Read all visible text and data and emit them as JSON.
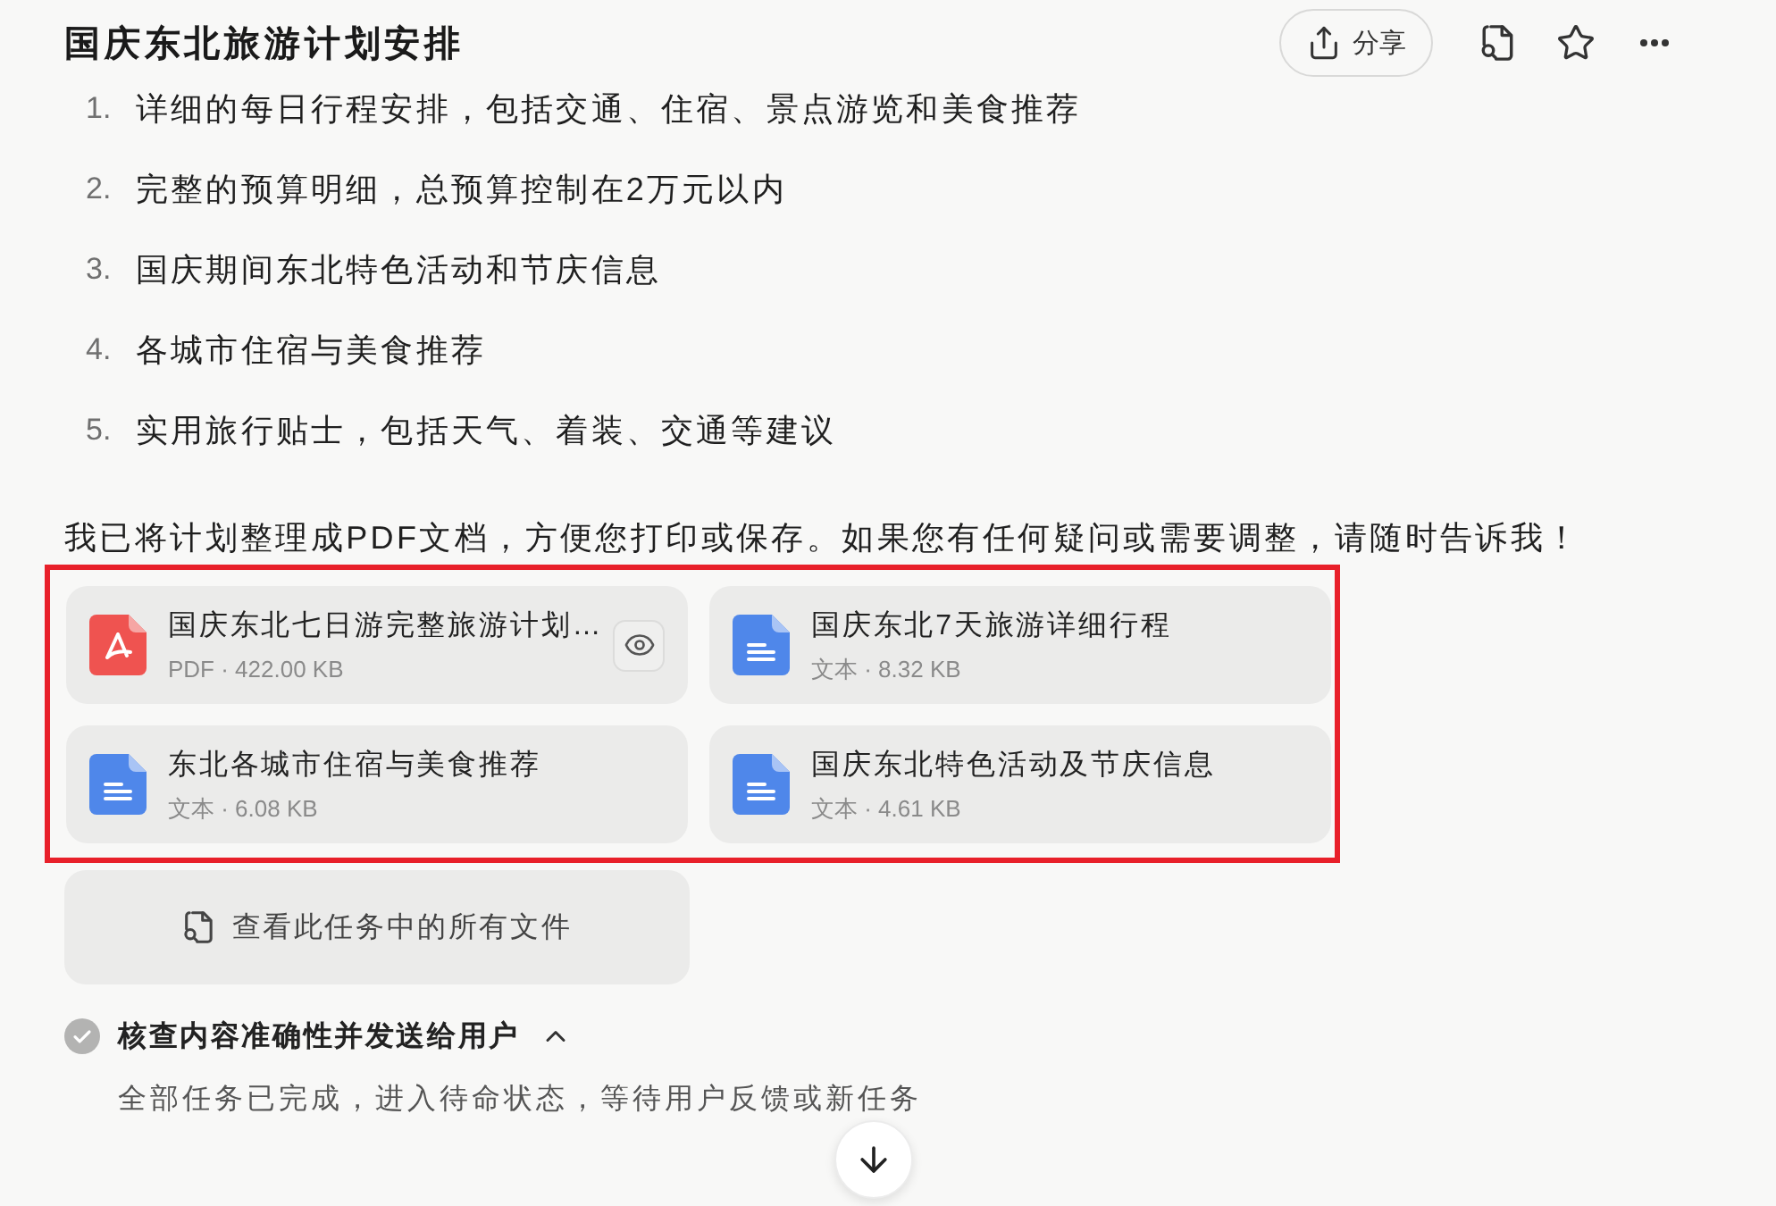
{
  "header": {
    "title": "国庆东北旅游计划安排",
    "share_button": "分享"
  },
  "deliverables": [
    {
      "number": "1.",
      "text": "详细的每日行程安排，包括交通、住宿、景点游览和美食推荐"
    },
    {
      "number": "2.",
      "text": "完整的预算明细，总预算控制在2万元以内"
    },
    {
      "number": "3.",
      "text": "国庆期间东北特色活动和节庆信息"
    },
    {
      "number": "4.",
      "text": "各城市住宿与美食推荐"
    },
    {
      "number": "5.",
      "text": "实用旅行贴士，包括天气、着装、交通等建议"
    }
  ],
  "message": "我已将计划整理成PDF文档，方便您打印或保存。如果您有任何疑问或需要调整，请随时告诉我！",
  "attachments": {
    "highlighted": true,
    "files": [
      {
        "kind": "pdf",
        "name": "国庆东北七日游完整旅游计划…",
        "meta": "PDF · 422.00 KB",
        "preview": true
      },
      {
        "kind": "text",
        "name": "国庆东北7天旅游详细行程",
        "meta": "文本 · 8.32 KB",
        "preview": false
      },
      {
        "kind": "text",
        "name": "东北各城市住宿与美食推荐",
        "meta": "文本 · 6.08 KB",
        "preview": false
      },
      {
        "kind": "text",
        "name": "国庆东北特色活动及节庆信息",
        "meta": "文本 · 4.61 KB",
        "preview": false
      }
    ]
  },
  "view_all_button": "查看此任务中的所有文件",
  "task": {
    "title": "核查内容准确性并发送给用户",
    "done": true,
    "expanded": true,
    "detail": "全部任务已完成，进入待命状态，等待用户反馈或新任务"
  }
}
